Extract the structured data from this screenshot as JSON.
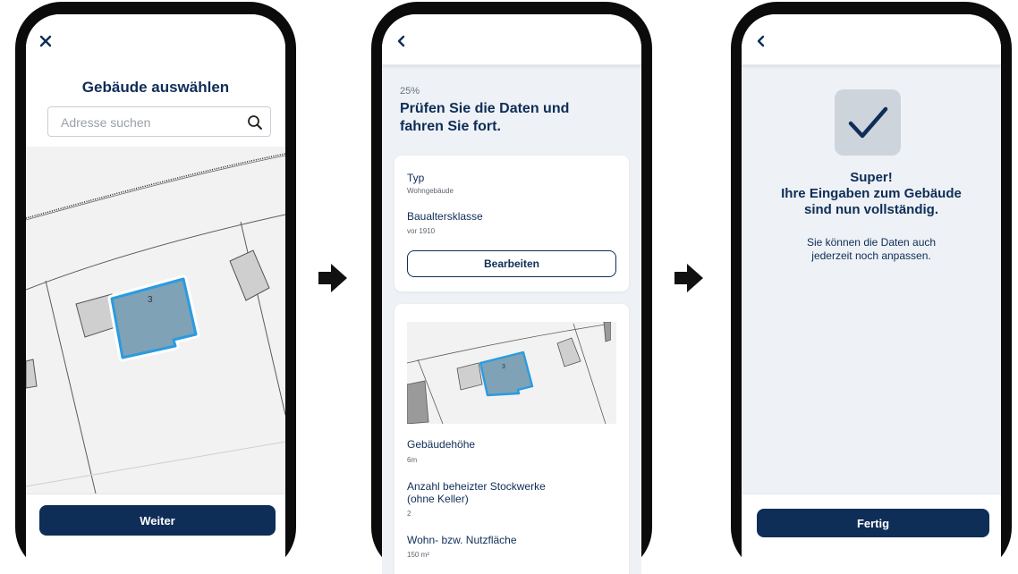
{
  "screen1": {
    "close_icon": "close-icon",
    "title": "Gebäude auswählen",
    "search": {
      "placeholder": "Adresse suchen",
      "icon": "search-icon"
    },
    "map": {
      "building_label": "3"
    },
    "continue_label": "Weiter"
  },
  "screen2": {
    "back_icon": "chevron-left-icon",
    "progress": "25%",
    "title": "Prüfen Sie die Daten und fahren Sie fort.",
    "card1": {
      "type_label": "Typ",
      "type_value": "Wohngebäude",
      "age_label": "Baualtersklasse",
      "age_value": "vor 1910",
      "edit_label": "Bearbeiten"
    },
    "card2": {
      "map_building_label": "3",
      "height_label": "Gebäudehöhe",
      "height_value": "6m",
      "floors_label_line1": "Anzahl beheizter Stockwerke",
      "floors_label_line2": "(ohne Keller)",
      "floors_value": "2",
      "area_label": "Wohn- bzw. Nutzfläche",
      "area_value": "150 m²"
    }
  },
  "screen3": {
    "back_icon": "chevron-left-icon",
    "check_icon": "checkmark-icon",
    "headline_line1": "Super!",
    "headline_line2": "Ihre Eingaben zum Gebäude",
    "headline_line3": "sind nun vollständig.",
    "text_line1": "Sie können die Daten auch",
    "text_line2": "jederzeit noch anpassen.",
    "done_label": "Fertig"
  },
  "colors": {
    "primary": "#0e2d57",
    "building_fill": "#7fa2b7",
    "building_outline": "#2a9be0",
    "screen_bg": "#eef1f5"
  },
  "flow_arrows": [
    "arrow-right-icon",
    "arrow-right-icon"
  ]
}
